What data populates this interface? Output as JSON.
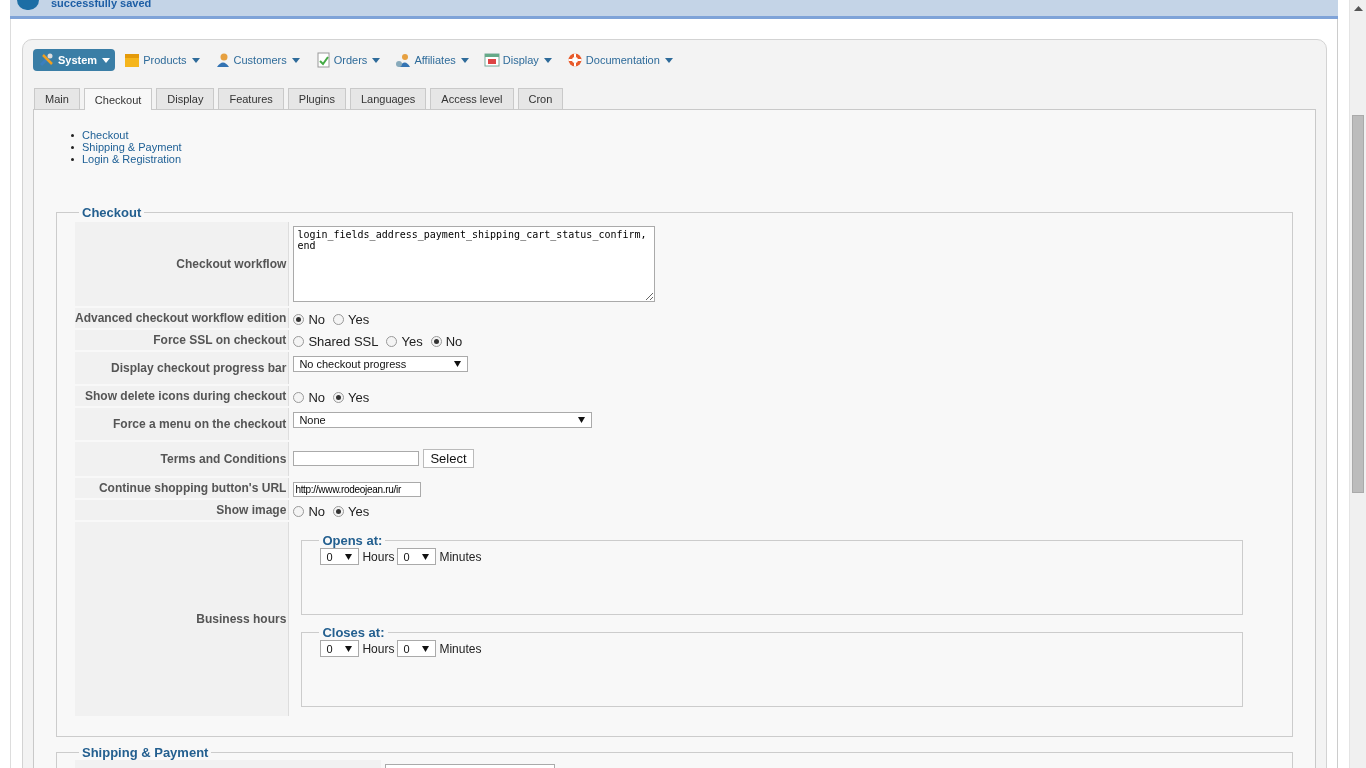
{
  "message": {
    "text": "successfully saved"
  },
  "menu": [
    {
      "label": "System",
      "selected": true
    },
    {
      "label": "Products",
      "selected": false
    },
    {
      "label": "Customers",
      "selected": false
    },
    {
      "label": "Orders",
      "selected": false
    },
    {
      "label": "Affiliates",
      "selected": false
    },
    {
      "label": "Display",
      "selected": false
    },
    {
      "label": "Documentation",
      "selected": false
    }
  ],
  "tabs": [
    {
      "label": "Main",
      "selected": false
    },
    {
      "label": "Checkout",
      "selected": true
    },
    {
      "label": "Display",
      "selected": false
    },
    {
      "label": "Features",
      "selected": false
    },
    {
      "label": "Plugins",
      "selected": false
    },
    {
      "label": "Languages",
      "selected": false
    },
    {
      "label": "Access level",
      "selected": false
    },
    {
      "label": "Cron",
      "selected": false
    }
  ],
  "section_links": [
    "Checkout",
    "Shipping & Payment",
    "Login & Registration"
  ],
  "checkout": {
    "legend": "Checkout",
    "rows": [
      {
        "label": "Checkout workflow",
        "kind": "textarea",
        "value": "login_fields_address_payment_shipping_cart_status_confirm,end"
      },
      {
        "label": "Advanced checkout workflow edition",
        "kind": "radio",
        "options": [
          {
            "label": "No",
            "selected": true
          },
          {
            "label": "Yes",
            "selected": false
          }
        ]
      },
      {
        "label": "Force SSL on checkout",
        "kind": "radio",
        "options": [
          {
            "label": "Shared SSL",
            "selected": false
          },
          {
            "label": "Yes",
            "selected": false
          },
          {
            "label": "No",
            "selected": true
          }
        ]
      },
      {
        "label": "Display checkout progress bar",
        "kind": "select",
        "value": "No checkout progress",
        "wide": false
      },
      {
        "label": "Show delete icons during checkout",
        "kind": "radio",
        "options": [
          {
            "label": "No",
            "selected": false
          },
          {
            "label": "Yes",
            "selected": true
          }
        ]
      },
      {
        "label": "Force a menu on the checkout",
        "kind": "select",
        "value": "None",
        "wide": true
      },
      {
        "label": "Terms and Conditions",
        "kind": "picker",
        "button": "Select"
      },
      {
        "label": "Continue shopping button's URL",
        "kind": "text",
        "value": "http://www.rodeojean.ru/ir"
      },
      {
        "label": "Show image",
        "kind": "radio",
        "options": [
          {
            "label": "No",
            "selected": false
          },
          {
            "label": "Yes",
            "selected": true
          }
        ]
      },
      {
        "label": "Business hours",
        "kind": "hours",
        "groups": [
          {
            "legend": "Opens at:",
            "hours": "0",
            "hours_label": "Hours",
            "minutes": "0",
            "minutes_label": "Minutes"
          },
          {
            "legend": "Closes at:",
            "hours": "0",
            "hours_label": "Hours",
            "minutes": "0",
            "minutes_label": "Minutes"
          }
        ]
      }
    ]
  },
  "shipping": {
    "legend": "Shipping & Payment"
  }
}
